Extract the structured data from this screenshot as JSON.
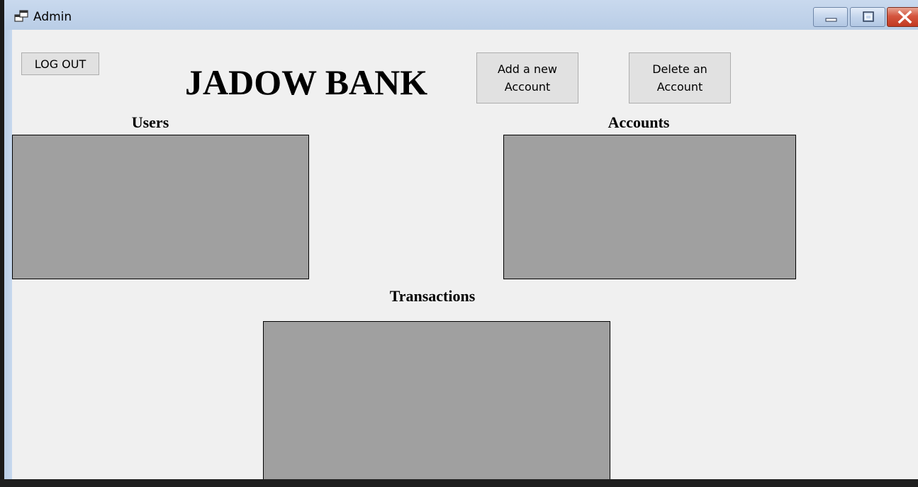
{
  "window": {
    "title": "Admin",
    "icon": "windows-form-icon",
    "controls": {
      "minimize_icon": "minimize-icon",
      "maximize_icon": "maximize-icon",
      "close_icon": "close-icon"
    }
  },
  "header": {
    "logout_label": "LOG OUT",
    "bank_name": "JADOW BANK",
    "add_account_label": "Add a new Account",
    "delete_account_label": "Delete an Account"
  },
  "sections": {
    "users_label": "Users",
    "accounts_label": "Accounts",
    "transactions_label": "Transactions"
  },
  "colors": {
    "client_background": "#f0f0f0",
    "grid_background": "#a0a0a0",
    "button_background": "#e1e1e1",
    "close_button": "#c23a22"
  }
}
